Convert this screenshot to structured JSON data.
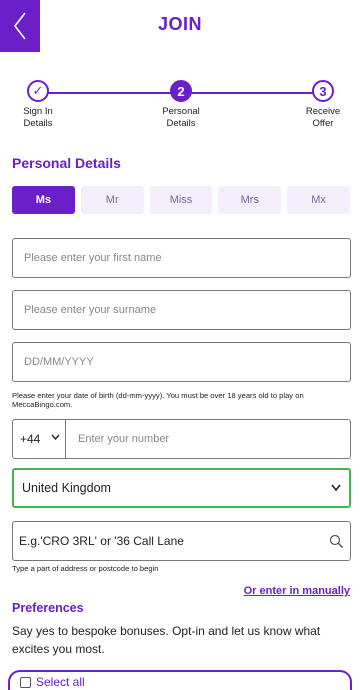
{
  "header": {
    "title": "JOIN",
    "back_icon": "chevron-left-icon"
  },
  "colors": {
    "brand_purple": "#6a1fc9",
    "valid_green": "#44b553"
  },
  "stepper": {
    "steps": [
      {
        "marker": "✓",
        "label_line1": "Sign In",
        "label_line2": "Details",
        "state": "completed"
      },
      {
        "marker": "2",
        "label_line1": "Personal",
        "label_line2": "Details",
        "state": "active"
      },
      {
        "marker": "3",
        "label_line1": "Receive",
        "label_line2": "Offer",
        "state": "upcoming"
      }
    ]
  },
  "personal_details": {
    "heading": "Personal Details",
    "titles": [
      "Ms",
      "Mr",
      "Miss",
      "Mrs",
      "Mx"
    ],
    "selected_title": "Ms",
    "first_name_placeholder": "Please enter your first name",
    "surname_placeholder": "Please enter your surname",
    "dob_placeholder": "DD/MM/YYYY",
    "dob_help": "Please enter your date of birth (dd-mm-yyyy). You must be over 18 years old to play on MeccaBingo.com.",
    "phone_code": "+44",
    "phone_placeholder": "Enter your number",
    "country": "United Kingdom",
    "address_value": "E.g.'CRO 3RL' or '36 Call Lane",
    "address_help": "Type a part of address or postcode to begin",
    "manual_link": "Or enter in manually"
  },
  "preferences": {
    "heading": "Preferences",
    "description": "Say yes to bespoke bonuses. Opt-in and let us know what excites you most.",
    "select_all_label": "Select all"
  }
}
